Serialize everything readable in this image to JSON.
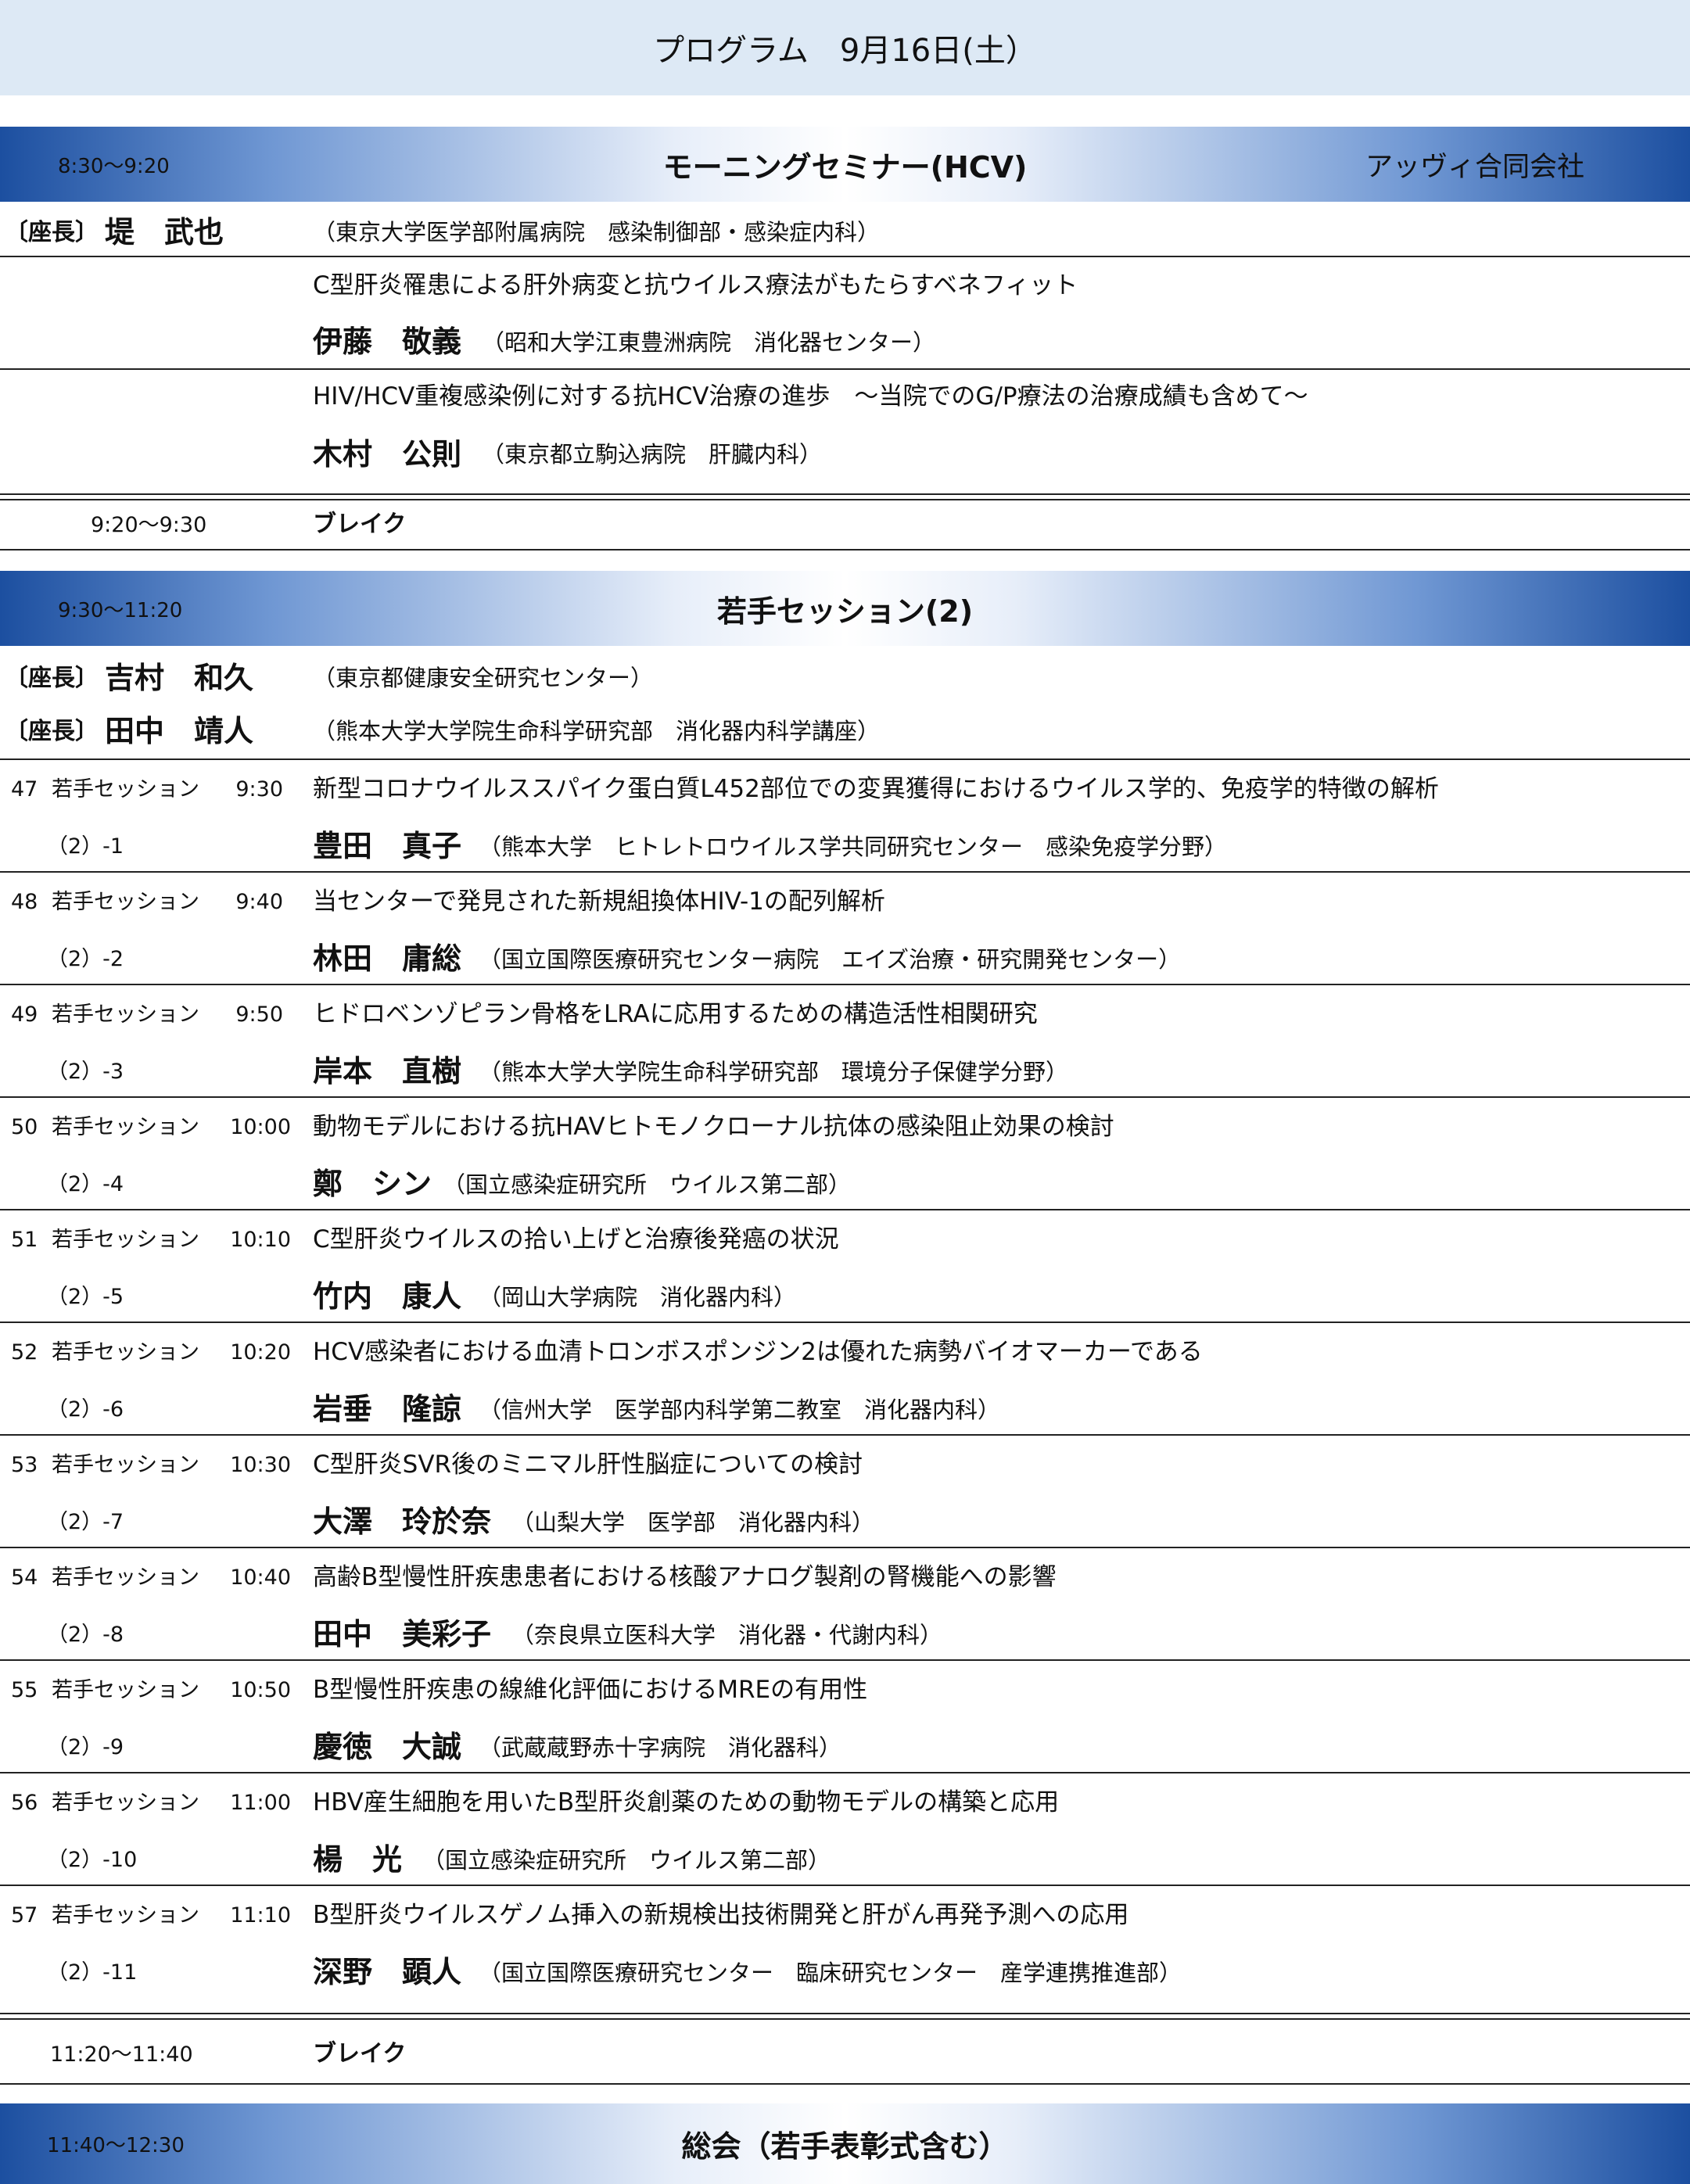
{
  "header": {
    "title": "プログラム　9月16日(土）"
  },
  "morning": {
    "time": "8:30～9:20",
    "title": "モーニングセミナー(HCV)",
    "sponsor": "アッヴィ合同会社",
    "chair": {
      "tag": "〔座長〕",
      "name": "堤　武也",
      "affiliation": "（東京大学医学部附属病院　感染制御部・感染症内科）"
    },
    "talks": [
      {
        "title": "C型肝炎罹患による肝外病変と抗ウイルス療法がもたらすベネフィット",
        "speaker": "伊藤　敬義",
        "affiliation": "（昭和大学江東豊洲病院　消化器センター）"
      },
      {
        "title": "HIV/HCV重複感染例に対する抗HCV治療の進歩　～当院でのG/P療法の治療成績も含めて～",
        "speaker": "木村　公則",
        "affiliation": "（東京都立駒込病院　肝臓内科）"
      }
    ]
  },
  "break1": {
    "time": "9:20～9:30",
    "label": "ブレイク"
  },
  "young": {
    "time": "9:30～11:20",
    "title": "若手セッション(2)",
    "chairs": [
      {
        "tag": "〔座長〕",
        "name": "吉村　和久",
        "affiliation": "（東京都健康安全研究センター）"
      },
      {
        "tag": "〔座長〕",
        "name": "田中　靖人",
        "affiliation": "（熊本大学大学院生命科学研究部　消化器内科学講座）"
      }
    ],
    "talks": [
      {
        "no": "47",
        "session": "若手セッション",
        "time": "9:30",
        "sub": "（2）-1",
        "title": "新型コロナウイルススパイク蛋白質L452部位での変異獲得におけるウイルス学的、免疫学的特徴の解析",
        "speaker": "豊田　真子",
        "affiliation": "（熊本大学　ヒトレトロウイルス学共同研究センター　感染免疫学分野）"
      },
      {
        "no": "48",
        "session": "若手セッション",
        "time": "9:40",
        "sub": "（2）-2",
        "title": "当センターで発見された新規組換体HIV-1の配列解析",
        "speaker": "林田　庸総",
        "affiliation": "（国立国際医療研究センター病院　エイズ治療・研究開発センター）"
      },
      {
        "no": "49",
        "session": "若手セッション",
        "time": "9:50",
        "sub": "（2）-3",
        "title": "ヒドロベンゾピラン骨格をLRAに応用するための構造活性相関研究",
        "speaker": "岸本　直樹",
        "affiliation": "（熊本大学大学院生命科学研究部　環境分子保健学分野）"
      },
      {
        "no": "50",
        "session": "若手セッション",
        "time": "10:00",
        "sub": "（2）-4",
        "title": "動物モデルにおける抗HAVヒトモノクローナル抗体の感染阻止効果の検討",
        "speaker": "鄭　シン",
        "affiliation": "（国立感染症研究所　ウイルス第二部）"
      },
      {
        "no": "51",
        "session": "若手セッション",
        "time": "10:10",
        "sub": "（2）-5",
        "title": "C型肝炎ウイルスの拾い上げと治療後発癌の状況",
        "speaker": "竹内　康人",
        "affiliation": "（岡山大学病院　消化器内科）"
      },
      {
        "no": "52",
        "session": "若手セッション",
        "time": "10:20",
        "sub": "（2）-6",
        "title": "HCV感染者における血清トロンボスポンジン2は優れた病勢バイオマーカーである",
        "speaker": "岩垂　隆諒",
        "affiliation": "（信州大学　医学部内科学第二教室　消化器内科）"
      },
      {
        "no": "53",
        "session": "若手セッション",
        "time": "10:30",
        "sub": "（2）-7",
        "title": "C型肝炎SVR後のミニマル肝性脳症についての検討",
        "speaker": "大澤　玲於奈",
        "affiliation": "（山梨大学　医学部　消化器内科）"
      },
      {
        "no": "54",
        "session": "若手セッション",
        "time": "10:40",
        "sub": "（2）-8",
        "title": "高齢B型慢性肝疾患患者における核酸アナログ製剤の腎機能への影響",
        "speaker": "田中　美彩子",
        "affiliation": "（奈良県立医科大学　消化器・代謝内科）"
      },
      {
        "no": "55",
        "session": "若手セッション",
        "time": "10:50",
        "sub": "（2）-9",
        "title": "B型慢性肝疾患の線維化評価におけるMREの有用性",
        "speaker": "慶徳　大誠",
        "affiliation": "（武蔵蔵野赤十字病院　消化器科）"
      },
      {
        "no": "56",
        "session": "若手セッション",
        "time": "11:00",
        "sub": "（2）-10",
        "title": "HBV産生細胞を用いたB型肝炎創薬のための動物モデルの構築と応用",
        "speaker": "楊　光",
        "affiliation": "（国立感染症研究所　ウイルス第二部）"
      },
      {
        "no": "57",
        "session": "若手セッション",
        "time": "11:10",
        "sub": "（2）-11",
        "title": "B型肝炎ウイルスゲノム挿入の新規検出技術開発と肝がん再発予測への応用",
        "speaker": "深野　顕人",
        "affiliation": "（国立国際医療研究センター　臨床研究センター　産学連携推進部）"
      }
    ]
  },
  "break2": {
    "time": "11:20～11:40",
    "label": "ブレイク"
  },
  "general": {
    "time": "11:40～12:30",
    "title": "総会（若手表彰式含む）"
  }
}
